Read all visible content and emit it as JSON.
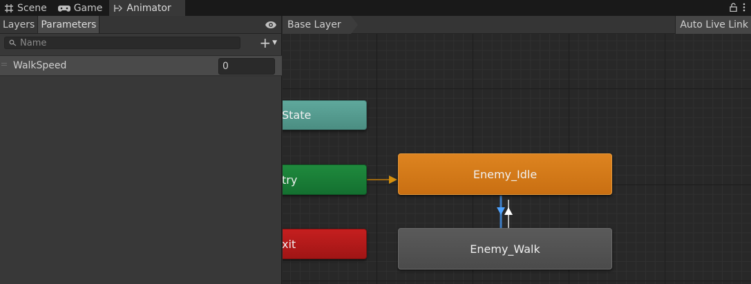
{
  "tabs": [
    {
      "label": "Scene",
      "icon": "grid-icon"
    },
    {
      "label": "Game",
      "icon": "gamepad-icon"
    },
    {
      "label": "Animator",
      "icon": "animator-icon",
      "active": true
    }
  ],
  "left_panel": {
    "tabs": [
      "Layers",
      "Parameters"
    ],
    "active_tab": "Parameters",
    "search_placeholder": "Name",
    "parameters": [
      {
        "name": "WalkSpeed",
        "value": "0"
      }
    ]
  },
  "graph": {
    "breadcrumb": "Base Layer",
    "live_link": "Auto Live Link",
    "nodes": {
      "any_state": "State",
      "entry": "try",
      "exit": "xit",
      "idle": "Enemy_Idle",
      "walk": "Enemy_Walk"
    }
  },
  "colors": {
    "default_state": "#dd8420",
    "state": "#555555",
    "any_state": "#5fa89c",
    "entry": "#1f8a3d",
    "exit": "#c51f1f",
    "transition_selected": "#4ea3ff"
  }
}
